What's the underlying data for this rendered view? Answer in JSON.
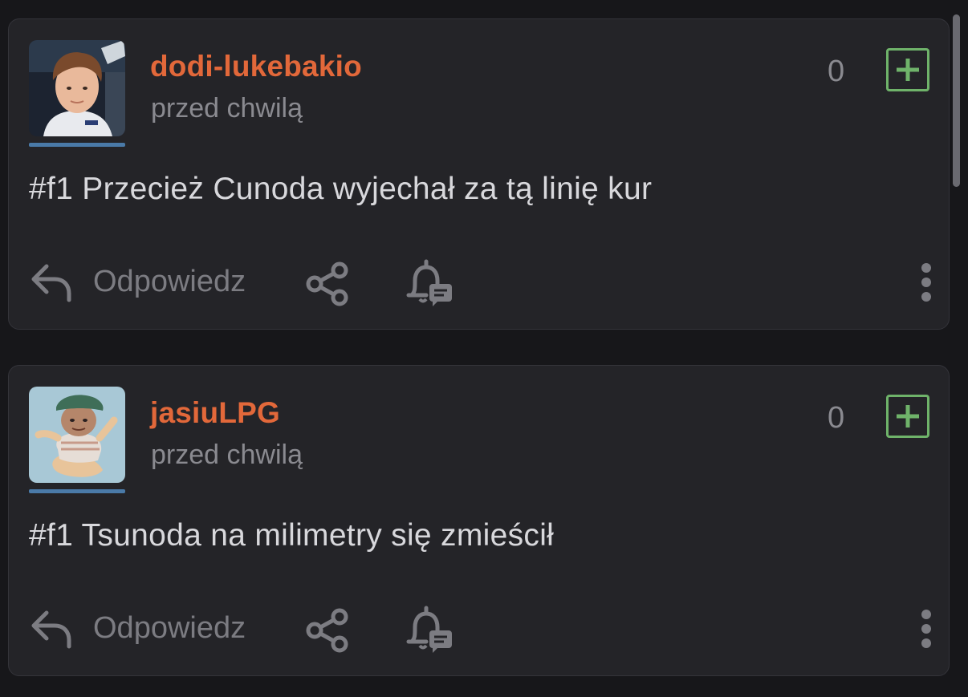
{
  "posts": [
    {
      "username": "dodi-lukebakio",
      "timestamp": "przed chwilą",
      "votes": "0",
      "body": "#f1 Przecież Cunoda wyjechał za tą linię kur",
      "reply_label": "Odpowiedz"
    },
    {
      "username": "jasiuLPG",
      "timestamp": "przed chwilą",
      "votes": "0",
      "body": "#f1 Tsunoda na milimetry się zmieścił",
      "reply_label": "Odpowiedz"
    }
  ],
  "colors": {
    "background": "#17171a",
    "card": "#242428",
    "username": "#e2683a",
    "plus_accent": "#6fb36a",
    "avatar_bar": "#4a7aa8",
    "muted_text": "#8a8a90"
  },
  "icons": [
    "reply-icon",
    "share-icon",
    "bell-comment-icon",
    "more-vertical-icon",
    "plus-icon"
  ]
}
